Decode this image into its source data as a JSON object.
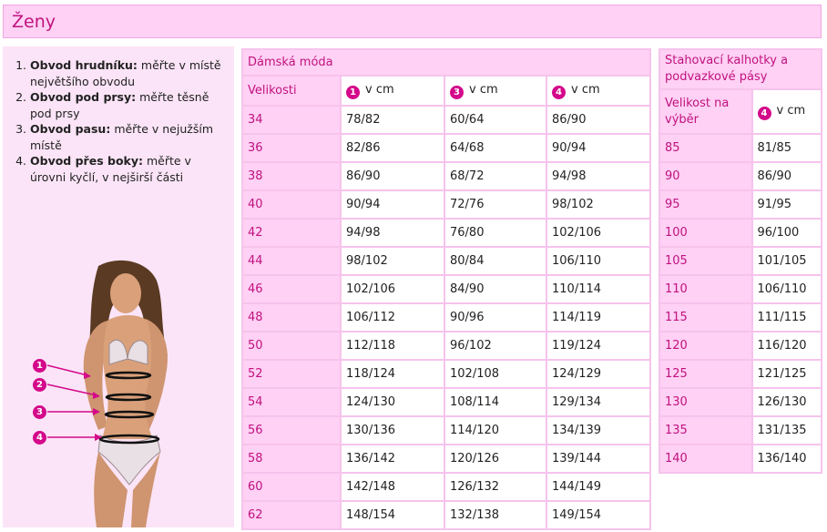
{
  "header": {
    "title": "Ženy"
  },
  "instructions": [
    {
      "bold": "Obvod hrudníku:",
      "text": " měřte v místě největšího obvodu"
    },
    {
      "bold": "Obvod pod prsy:",
      "text": " měřte těsně pod prsy"
    },
    {
      "bold": "Obvod pasu:",
      "text": " měřte v nejužším místě"
    },
    {
      "bold": "Obvod přes boky:",
      "text": " měřte v úrovni kyčlí, v nejširší části"
    }
  ],
  "figure": {
    "markers": [
      "1",
      "2",
      "3",
      "4"
    ]
  },
  "colors": {
    "accent": "#c0127f",
    "marker": "#d4088a",
    "light_pink": "#ffd1f4",
    "border": "#f6c3ec"
  },
  "table_womens": {
    "caption": "Dámská móda",
    "size_header": "Velikosti",
    "columns": [
      {
        "marker": "1",
        "unit": "v cm"
      },
      {
        "marker": "3",
        "unit": "v cm"
      },
      {
        "marker": "4",
        "unit": "v cm"
      }
    ],
    "rows": [
      {
        "size": "34",
        "values": [
          "78/82",
          "60/64",
          "86/90"
        ]
      },
      {
        "size": "36",
        "values": [
          "82/86",
          "64/68",
          "90/94"
        ]
      },
      {
        "size": "38",
        "values": [
          "86/90",
          "68/72",
          "94/98"
        ]
      },
      {
        "size": "40",
        "values": [
          "90/94",
          "72/76",
          "98/102"
        ]
      },
      {
        "size": "42",
        "values": [
          "94/98",
          "76/80",
          "102/106"
        ]
      },
      {
        "size": "44",
        "values": [
          "98/102",
          "80/84",
          "106/110"
        ]
      },
      {
        "size": "46",
        "values": [
          "102/106",
          "84/90",
          "110/114"
        ]
      },
      {
        "size": "48",
        "values": [
          "106/112",
          "90/96",
          "114/119"
        ]
      },
      {
        "size": "50",
        "values": [
          "112/118",
          "96/102",
          "119/124"
        ]
      },
      {
        "size": "52",
        "values": [
          "118/124",
          "102/108",
          "124/129"
        ]
      },
      {
        "size": "54",
        "values": [
          "124/130",
          "108/114",
          "129/134"
        ]
      },
      {
        "size": "56",
        "values": [
          "130/136",
          "114/120",
          "134/139"
        ]
      },
      {
        "size": "58",
        "values": [
          "136/142",
          "120/126",
          "139/144"
        ]
      },
      {
        "size": "60",
        "values": [
          "142/148",
          "126/132",
          "144/149"
        ]
      },
      {
        "size": "62",
        "values": [
          "148/154",
          "132/138",
          "149/154"
        ]
      }
    ]
  },
  "table_shapewear": {
    "caption": "Stahovací kalhotky a podvazkové pásy",
    "size_header": "Velikost na výběr",
    "column": {
      "marker": "4",
      "unit": "v cm"
    },
    "rows": [
      {
        "size": "85",
        "value": "81/85"
      },
      {
        "size": "90",
        "value": "86/90"
      },
      {
        "size": "95",
        "value": "91/95"
      },
      {
        "size": "100",
        "value": "96/100"
      },
      {
        "size": "105",
        "value": "101/105"
      },
      {
        "size": "110",
        "value": "106/110"
      },
      {
        "size": "115",
        "value": "111/115"
      },
      {
        "size": "120",
        "value": "116/120"
      },
      {
        "size": "125",
        "value": "121/125"
      },
      {
        "size": "130",
        "value": "126/130"
      },
      {
        "size": "135",
        "value": "131/135"
      },
      {
        "size": "140",
        "value": "136/140"
      }
    ]
  }
}
